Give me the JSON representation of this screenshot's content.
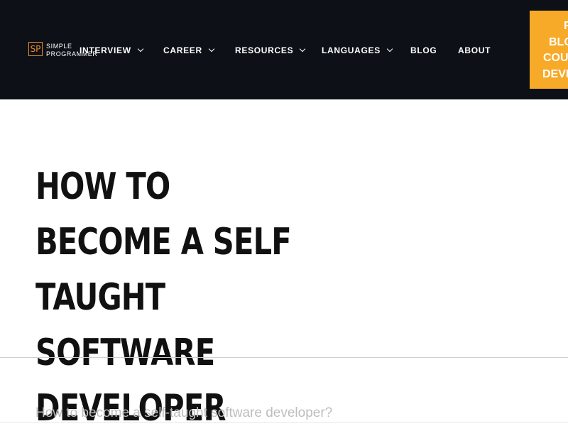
{
  "logo": {
    "mark": "SP",
    "line1": "SIMPLE",
    "line2": "PROGRAMMER"
  },
  "nav": [
    {
      "label": "INTERVIEW",
      "dropdown": true
    },
    {
      "label": "CAREER",
      "dropdown": true
    },
    {
      "label": "RESOURCES",
      "dropdown": true
    },
    {
      "label": "LANGUAGES",
      "dropdown": true
    },
    {
      "label": "BLOG",
      "dropdown": false
    },
    {
      "label": "ABOUT",
      "dropdown": false
    }
  ],
  "cta": {
    "line1": "F",
    "line2": "BLO",
    "line3": "COU",
    "line4": "DEVE"
  },
  "article": {
    "title": "How to Become a Self Taught Software Developer",
    "subtitle": "How to become a self-taught software developer?"
  },
  "colors": {
    "header_bg": "#0d1117",
    "accent": "#f7a928",
    "logo_orange": "#e58a2b"
  }
}
